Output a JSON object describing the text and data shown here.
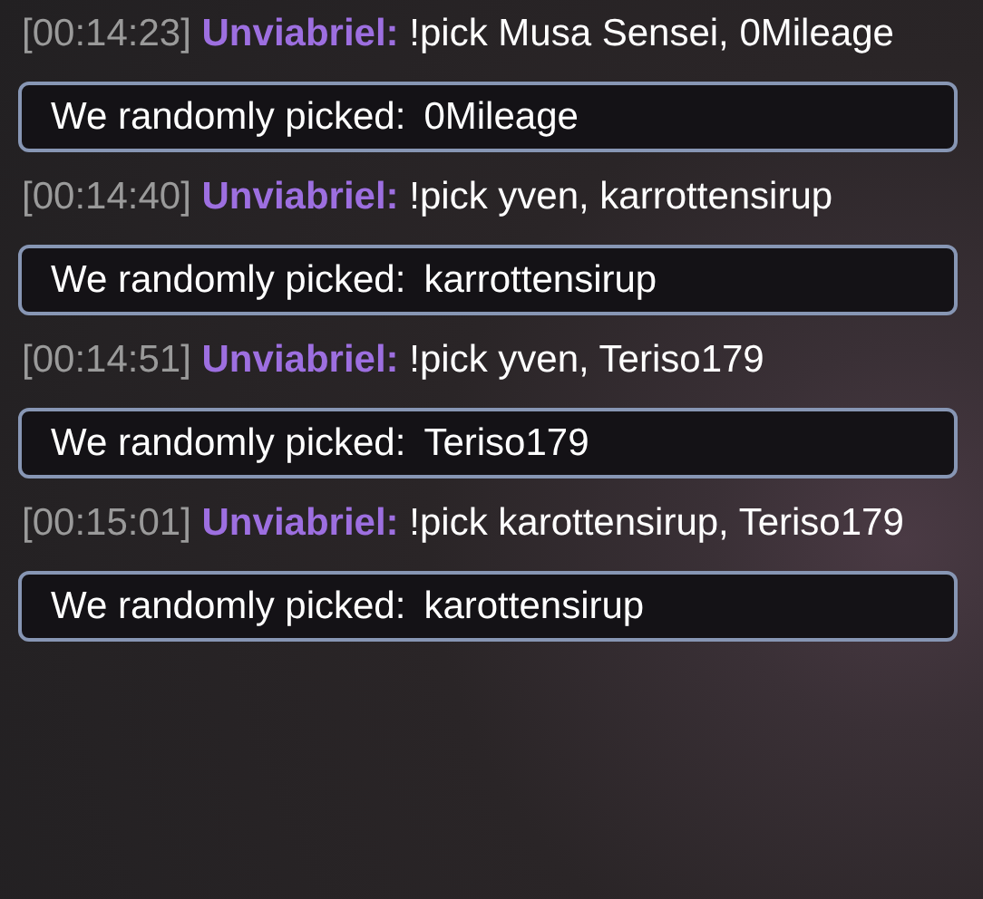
{
  "messages": [
    {
      "time": "[00:14:23]",
      "user": "Unviabriel:",
      "text": "!pick Musa Sensei, 0Mileage",
      "reply": {
        "label": "We randomly picked:",
        "value": "0Mileage"
      }
    },
    {
      "time": "[00:14:40]",
      "user": "Unviabriel:",
      "text": "!pick yven, karrottensirup",
      "reply": {
        "label": "We randomly picked:",
        "value": "karrottensirup"
      }
    },
    {
      "time": "[00:14:51]",
      "user": "Unviabriel:",
      "text": "!pick yven, Teriso179",
      "reply": {
        "label": "We randomly picked:",
        "value": "Teriso179"
      }
    },
    {
      "time": "[00:15:01]",
      "user": "Unviabriel:",
      "text": "!pick karottensirup, Teriso179",
      "reply": {
        "label": "We randomly picked:",
        "value": "karottensirup"
      }
    }
  ]
}
